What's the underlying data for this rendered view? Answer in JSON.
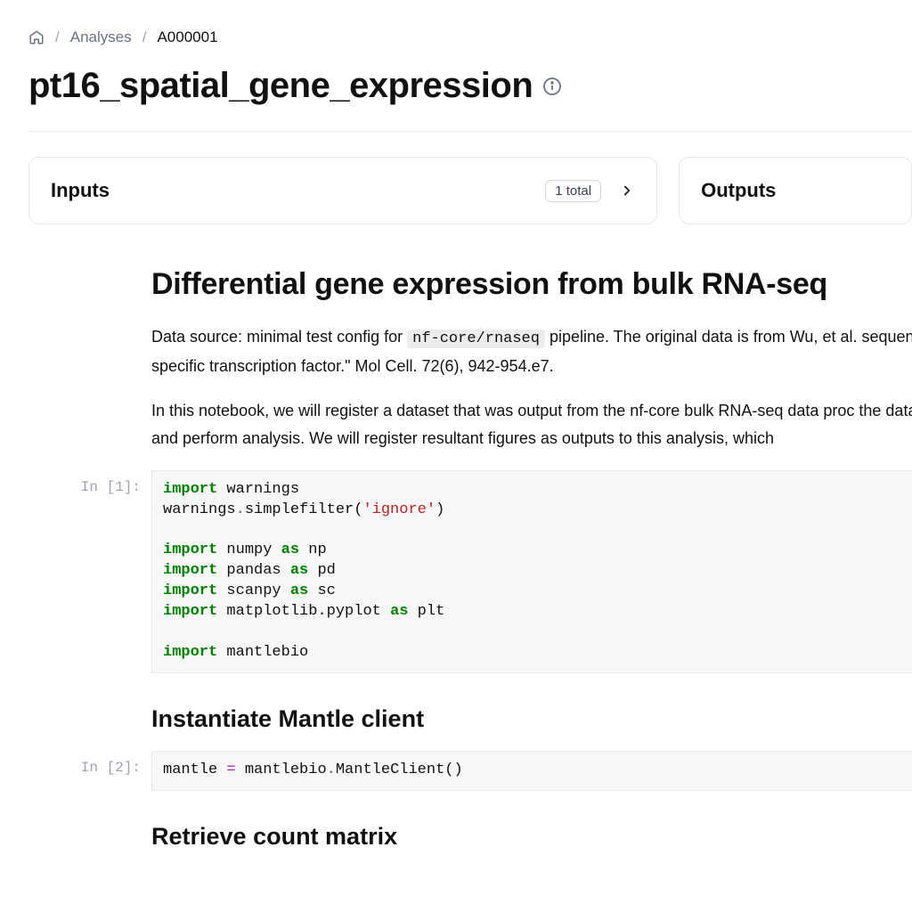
{
  "breadcrumb": {
    "home": "home",
    "link": "Analyses",
    "current": "A000001"
  },
  "page_title": "pt16_spatial_gene_expression",
  "cards": {
    "inputs": {
      "title": "Inputs",
      "badge": "1 total"
    },
    "outputs": {
      "title": "Outputs"
    }
  },
  "notebook": {
    "h1": "Differential gene expression from bulk RNA-seq",
    "p1_a": "Data source: minimal test config for ",
    "p1_code": "nf-core/rnaseq",
    "p1_b": " pipeline. The original data is from Wu, et al. sequence-specific transcription factor.\" Mol Cell. 72(6), 942-954.e7.",
    "p2": "In this notebook, we will register a dataset that was output from the nf-core bulk RNA-seq data proc the dataset, and perform analysis. We will register resultant figures as outputs to this analysis, which",
    "cells": [
      {
        "prompt": "In [1]:"
      },
      {
        "prompt": "In [2]:"
      }
    ],
    "h2_a": "Instantiate Mantle client",
    "h2_b": "Retrieve count matrix",
    "code1": {
      "l1_kw": "import",
      "l1_mod": "warnings",
      "l2_a": "warnings",
      "l2_b": "simplefilter",
      "l2_str": "'ignore'",
      "l3_kw": "import",
      "l3_mod": "numpy",
      "l3_as": "as",
      "l3_al": "np",
      "l4_kw": "import",
      "l4_mod": "pandas",
      "l4_as": "as",
      "l4_al": "pd",
      "l5_kw": "import",
      "l5_mod": "scanpy",
      "l5_as": "as",
      "l5_al": "sc",
      "l6_kw": "import",
      "l6_mod": "matplotlib.pyplot",
      "l6_as": "as",
      "l6_al": "plt",
      "l7_kw": "import",
      "l7_mod": "mantlebio"
    },
    "code2": {
      "a": "mantle ",
      "eq": "=",
      "b": " mantlebio",
      "c": "MantleClient()"
    }
  }
}
